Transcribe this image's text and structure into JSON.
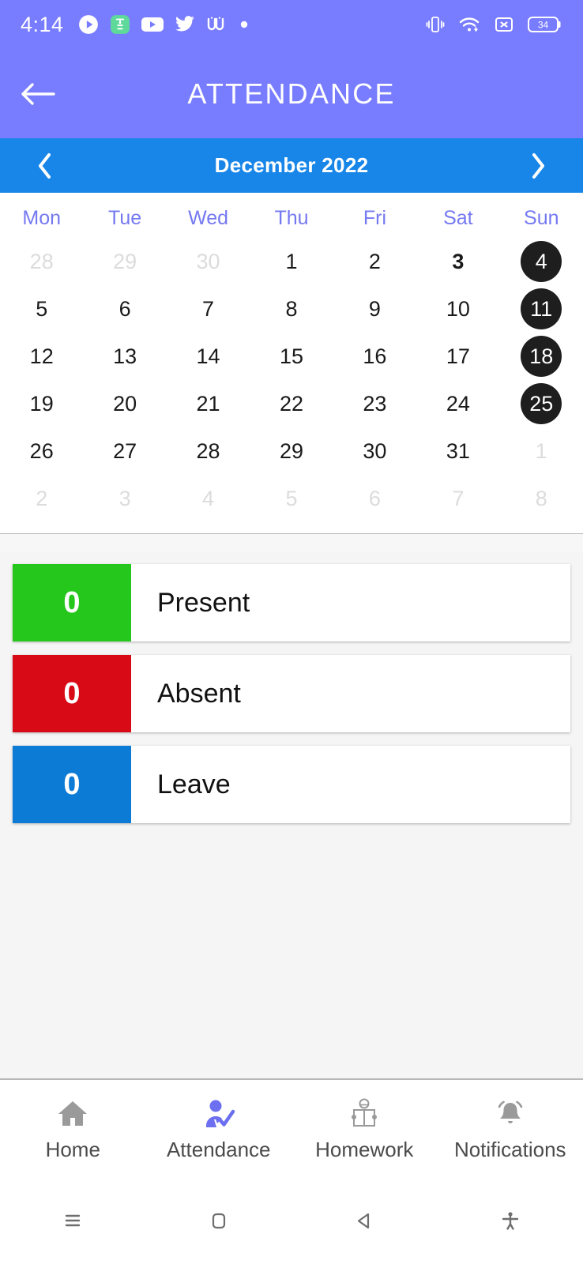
{
  "statusbar": {
    "time": "4:14",
    "left_icons": [
      "media-play-icon",
      "green-app-icon",
      "youtube-icon",
      "twitter-icon",
      "w-app-icon",
      "dot-icon"
    ],
    "right_icons": [
      "vibrate-icon",
      "wifi-icon",
      "no-sim-icon",
      "battery-icon"
    ],
    "battery_level": "34"
  },
  "header": {
    "title": "ATTENDANCE",
    "back_icon": "arrow-left-icon",
    "background": "#787CFE"
  },
  "monthbar": {
    "label": "December  2022",
    "prev_icon": "chevron-left-icon",
    "next_icon": "chevron-right-icon",
    "background": "#1886E8"
  },
  "calendar": {
    "weekdays": [
      "Mon",
      "Tue",
      "Wed",
      "Thu",
      "Fri",
      "Sat",
      "Sun"
    ],
    "weekday_color": "#7579F0",
    "selected_color": "#1E1E1E",
    "weeks": [
      [
        {
          "n": "28",
          "state": "muted"
        },
        {
          "n": "29",
          "state": "muted"
        },
        {
          "n": "30",
          "state": "muted"
        },
        {
          "n": "1",
          "state": "normal"
        },
        {
          "n": "2",
          "state": "normal"
        },
        {
          "n": "3",
          "state": "bold"
        },
        {
          "n": "4",
          "state": "selected"
        }
      ],
      [
        {
          "n": "5",
          "state": "normal"
        },
        {
          "n": "6",
          "state": "normal"
        },
        {
          "n": "7",
          "state": "normal"
        },
        {
          "n": "8",
          "state": "normal"
        },
        {
          "n": "9",
          "state": "normal"
        },
        {
          "n": "10",
          "state": "normal"
        },
        {
          "n": "11",
          "state": "selected"
        }
      ],
      [
        {
          "n": "12",
          "state": "normal"
        },
        {
          "n": "13",
          "state": "normal"
        },
        {
          "n": "14",
          "state": "normal"
        },
        {
          "n": "15",
          "state": "normal"
        },
        {
          "n": "16",
          "state": "normal"
        },
        {
          "n": "17",
          "state": "normal"
        },
        {
          "n": "18",
          "state": "selected"
        }
      ],
      [
        {
          "n": "19",
          "state": "normal"
        },
        {
          "n": "20",
          "state": "normal"
        },
        {
          "n": "21",
          "state": "normal"
        },
        {
          "n": "22",
          "state": "normal"
        },
        {
          "n": "23",
          "state": "normal"
        },
        {
          "n": "24",
          "state": "normal"
        },
        {
          "n": "25",
          "state": "selected"
        }
      ],
      [
        {
          "n": "26",
          "state": "normal"
        },
        {
          "n": "27",
          "state": "normal"
        },
        {
          "n": "28",
          "state": "normal"
        },
        {
          "n": "29",
          "state": "normal"
        },
        {
          "n": "30",
          "state": "normal"
        },
        {
          "n": "31",
          "state": "normal"
        },
        {
          "n": "1",
          "state": "muted"
        }
      ],
      [
        {
          "n": "2",
          "state": "muted"
        },
        {
          "n": "3",
          "state": "muted"
        },
        {
          "n": "4",
          "state": "muted"
        },
        {
          "n": "5",
          "state": "muted"
        },
        {
          "n": "6",
          "state": "muted"
        },
        {
          "n": "7",
          "state": "muted"
        },
        {
          "n": "8",
          "state": "muted"
        }
      ]
    ]
  },
  "stats": [
    {
      "count": "0",
      "label": "Present",
      "color": "#26C71D"
    },
    {
      "count": "0",
      "label": "Absent",
      "color": "#D80A16"
    },
    {
      "count": "0",
      "label": "Leave",
      "color": "#0C7BD6"
    }
  ],
  "bottomnav": {
    "items": [
      {
        "label": "Home",
        "icon": "home-icon",
        "active": false
      },
      {
        "label": "Attendance",
        "icon": "person-check-icon",
        "active": true
      },
      {
        "label": "Homework",
        "icon": "person-reading-icon",
        "active": false
      },
      {
        "label": "Notifications",
        "icon": "bell-icon",
        "active": false
      }
    ],
    "active_color": "#6B6FF0",
    "inactive_color": "#9a9a9a"
  },
  "sysnav": {
    "buttons": [
      "menu-icon",
      "home-square-icon",
      "back-triangle-icon",
      "accessibility-icon"
    ]
  }
}
